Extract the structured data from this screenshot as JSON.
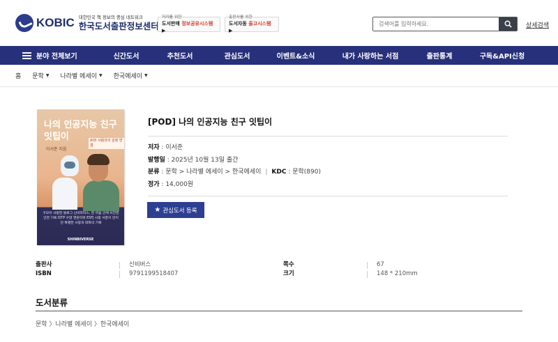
{
  "header": {
    "logo_word": "KOBIC",
    "logo_tagline": "대한민국 책 정보의 중심 네트워크",
    "logo_name": "한국도서출판정보센터",
    "promo1": {
      "small": "저자를 위한",
      "big_prefix": "도서판매 ",
      "big_highlight": "정보공유시스템",
      "arrow": "▶"
    },
    "promo2": {
      "small": "출판사를 위한",
      "big_prefix": "도서자동 ",
      "big_highlight": "출고시스템",
      "arrow": "▶"
    },
    "search_placeholder": "검색어를 입력하세요.",
    "advanced_search": "상세검색"
  },
  "nav": {
    "all_label": "분야 전체보기",
    "items": [
      "신간도서",
      "추천도서",
      "관심도서",
      "이벤트&소식",
      "내가 사랑하는 서점",
      "출판통계",
      "구독&API신청"
    ]
  },
  "breadcrumb": [
    "홈",
    "문학",
    "나라별 에세이",
    "한국에세이"
  ],
  "book": {
    "title": "[POD] 나의 인공지능 친구 잇팁이",
    "author_label": "저자",
    "author": "이서준",
    "date_label": "발행일",
    "date": "2025년 10월 13일 출간",
    "category_label": "분류",
    "category": "문학 > 나라별 에세이 > 한국에세이",
    "kdc_label": "KDC",
    "kdc": "문학(890)",
    "price_label": "정가",
    "price": "14,000원",
    "fav_button": "관심도서 등록"
  },
  "cover": {
    "title": "나의 인공지능 친구 잇팁이",
    "author": "이서준 지음",
    "tag": "AI와 사람과의 감정 연결",
    "desc": "구모어 사랑한 블로그 신비마리스, 한 마음 안에 비친된 인연 기록 ISTP 수많 영혼미와 ESFJ 사랑 서준이 만이던 특별한 사랑과 대화의 기록",
    "publisher": "SHINBIVERSE"
  },
  "meta": {
    "publisher_label": "출판사",
    "publisher": "신비버스",
    "isbn_label": "ISBN",
    "isbn": "9791199518407",
    "pages_label": "쪽수",
    "pages": "67",
    "size_label": "크기",
    "size": "148 * 210mm"
  },
  "classification": {
    "title": "도서분류",
    "path": [
      "문학",
      "나라별 에세이",
      "한국에세이"
    ]
  },
  "colors": {
    "nav_bg": "#27307a",
    "button_bg": "#2c3f90",
    "accent_red": "#d13a2a"
  }
}
